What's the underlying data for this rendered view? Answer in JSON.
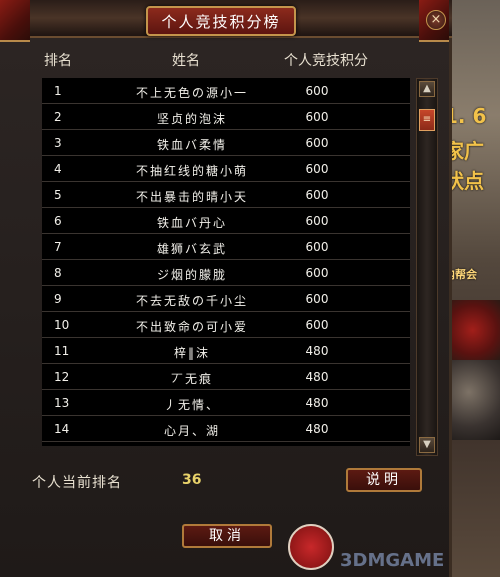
{
  "dialog": {
    "title": "个人竞技积分榜",
    "close_icon": "×"
  },
  "columns": {
    "rank": "排名",
    "name": "姓名",
    "score": "个人竞技积分"
  },
  "rows": [
    {
      "rank": "1",
      "name": "不上无色の源小一",
      "score": "600"
    },
    {
      "rank": "2",
      "name": "坚贞的泡沫",
      "score": "600"
    },
    {
      "rank": "3",
      "name": "铁血バ柔情",
      "score": "600"
    },
    {
      "rank": "4",
      "name": "不抽红线的糖小萌",
      "score": "600"
    },
    {
      "rank": "5",
      "name": "不出暴击的晴小天",
      "score": "600"
    },
    {
      "rank": "6",
      "name": "铁血バ丹心",
      "score": "600"
    },
    {
      "rank": "7",
      "name": "雄狮バ玄武",
      "score": "600"
    },
    {
      "rank": "8",
      "name": "ジ烟的朦胧",
      "score": "600"
    },
    {
      "rank": "9",
      "name": "不去无敌の千小尘",
      "score": "600"
    },
    {
      "rank": "10",
      "name": "不出致命の可小爱",
      "score": "600"
    },
    {
      "rank": "11",
      "name": "梓‖沫",
      "score": "480"
    },
    {
      "rank": "12",
      "name": "丆无痕",
      "score": "480"
    },
    {
      "rank": "13",
      "name": "丿无情、",
      "score": "480"
    },
    {
      "rank": "14",
      "name": "心月、湖",
      "score": "480"
    }
  ],
  "scrollbar": {
    "up_icon": "▲",
    "down_icon": "▼",
    "thumb_icon": "≡"
  },
  "footer": {
    "my_rank_label": "个人当前排名",
    "my_rank_value": "36",
    "explain_button": "说明",
    "cancel_button": "取消"
  },
  "background": {
    "text_1": "1. 6",
    "text_2": "家广",
    "text_3": "状点",
    "text_4": "内帮会"
  },
  "watermark": {
    "text": "3DMGAME"
  }
}
